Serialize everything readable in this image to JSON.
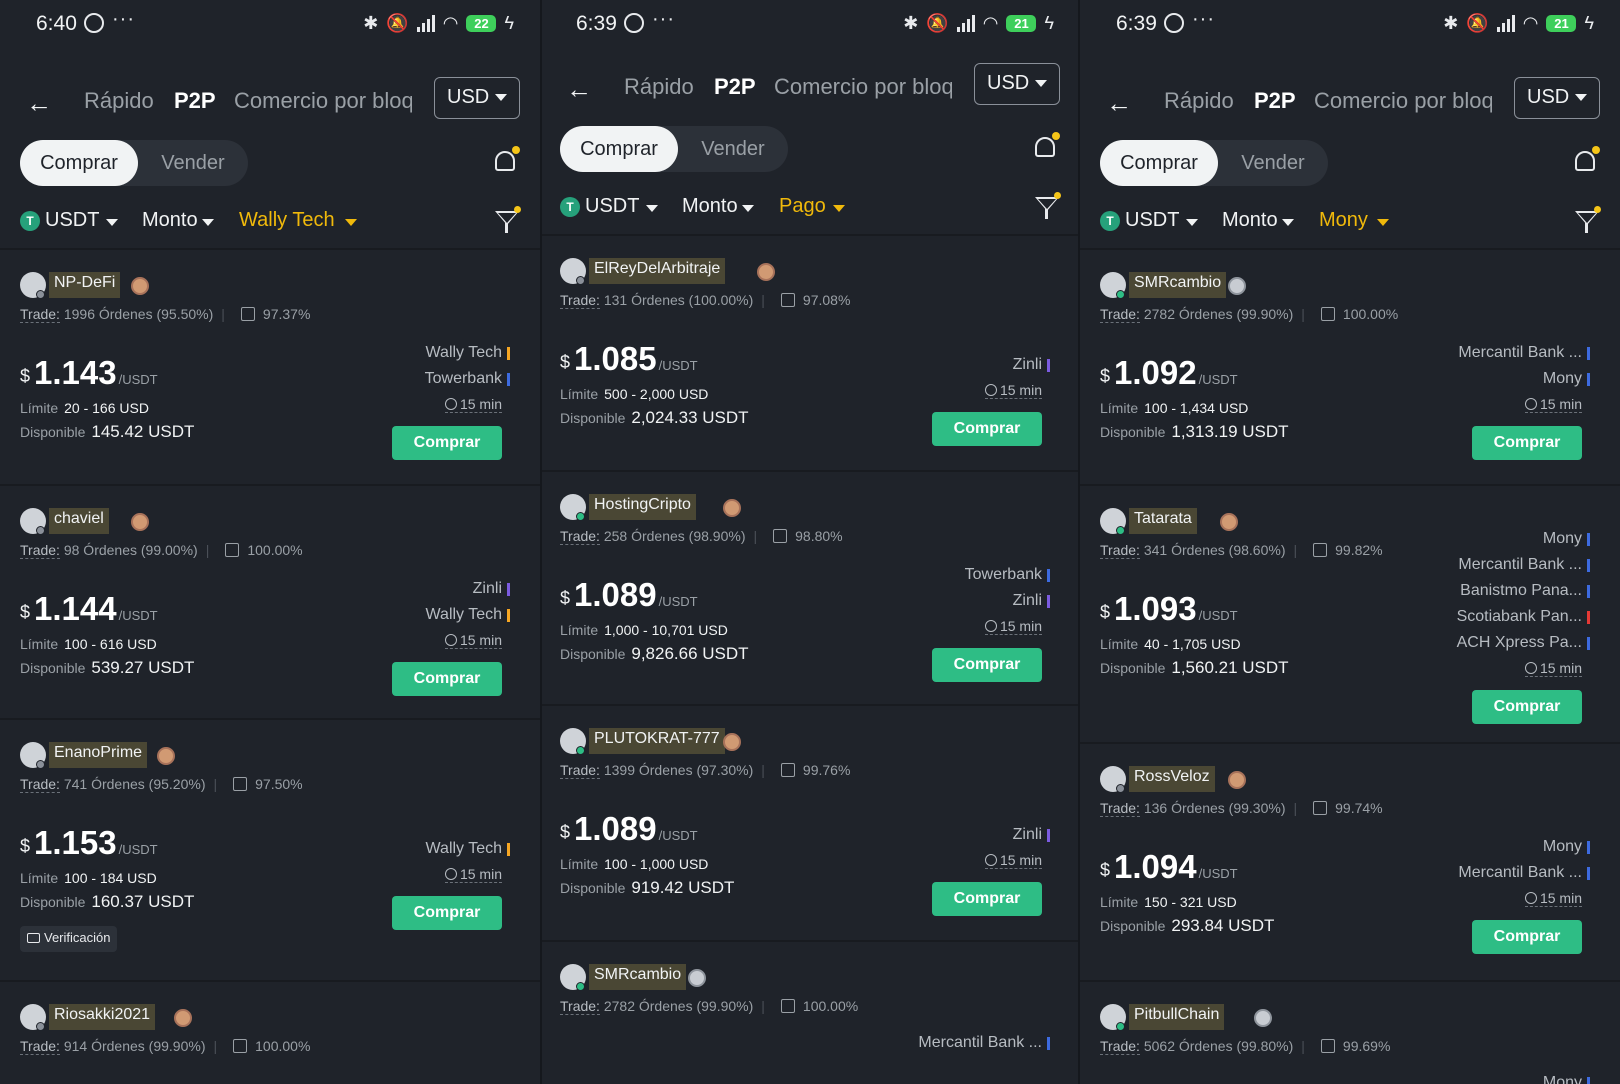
{
  "colors": {
    "background": "#1f232a",
    "buy_button": "#2ebd85",
    "filter_highlight": "#f0b90b",
    "battery": "#3ecf5b",
    "pay_bars": {
      "yellow": "#f5a623",
      "blue": "#3d6be0",
      "purple": "#7b5be0",
      "red": "#e53935"
    }
  },
  "panels": [
    {
      "status": {
        "time": "6:40",
        "dots": "···",
        "battery": "22"
      },
      "header": {
        "back": "←",
        "tab_fast": "Rápido",
        "tab_p2p": "P2P",
        "tab_block": "Comercio por bloq",
        "currency": "USD"
      },
      "toggle": {
        "buy": "Comprar",
        "sell": "Vender"
      },
      "filters": {
        "coin_icon": "T",
        "coin": "USDT",
        "amount": "Monto",
        "payment": "Wally Tech"
      },
      "offers": [
        {
          "name": "NP-DeFi",
          "badge": "bronze",
          "online": false,
          "trade": "Trade:",
          "orders": "1996 Órdenes (95.50%)",
          "rate": "97.37%",
          "currency_sign": "$",
          "price": "1.143",
          "unit": "/USDT",
          "limit_label": "Límite",
          "limit": "20 - 166 USD",
          "avail_label": "Disponible",
          "available": "145.42 USDT",
          "methods": [
            {
              "name": "Wally Tech",
              "color": "#f5a623"
            },
            {
              "name": "Towerbank",
              "color": "#3d6be0"
            }
          ],
          "time": "15 min",
          "button": "Comprar"
        },
        {
          "name": "chaviel",
          "badge": "bronze",
          "online": false,
          "trade": "Trade:",
          "orders": "98 Órdenes (99.00%)",
          "rate": "100.00%",
          "currency_sign": "$",
          "price": "1.144",
          "unit": "/USDT",
          "limit_label": "Límite",
          "limit": "100 - 616 USD",
          "avail_label": "Disponible",
          "available": "539.27 USDT",
          "methods": [
            {
              "name": "Zinli",
              "color": "#7b5be0"
            },
            {
              "name": "Wally Tech",
              "color": "#f5a623"
            }
          ],
          "time": "15 min",
          "button": "Comprar"
        },
        {
          "name": "EnanoPrime",
          "badge": "bronze",
          "online": false,
          "trade": "Trade:",
          "orders": "741 Órdenes (95.20%)",
          "rate": "97.50%",
          "currency_sign": "$",
          "price": "1.153",
          "unit": "/USDT",
          "limit_label": "Límite",
          "limit": "100 - 184 USD",
          "avail_label": "Disponible",
          "available": "160.37 USDT",
          "methods": [
            {
              "name": "Wally Tech",
              "color": "#f5a623"
            }
          ],
          "time": "15 min",
          "button": "Comprar",
          "verification": "Verificación"
        },
        {
          "name": "Riosakki2021",
          "badge": "bronze",
          "online": false,
          "trade": "Trade:",
          "orders": "914 Órdenes (99.90%)",
          "rate": "100.00%"
        }
      ]
    },
    {
      "status": {
        "time": "6:39",
        "dots": "···",
        "battery": "21"
      },
      "header": {
        "back": "←",
        "tab_fast": "Rápido",
        "tab_p2p": "P2P",
        "tab_block": "Comercio por bloq",
        "currency": "USD"
      },
      "toggle": {
        "buy": "Comprar",
        "sell": "Vender"
      },
      "filters": {
        "coin_icon": "T",
        "coin": "USDT",
        "amount": "Monto",
        "payment": "Pago"
      },
      "offers": [
        {
          "name": "ElReyDelArbitraje",
          "badge": "bronze",
          "online": false,
          "trade": "Trade:",
          "orders": "131 Órdenes (100.00%)",
          "rate": "97.08%",
          "currency_sign": "$",
          "price": "1.085",
          "unit": "/USDT",
          "limit_label": "Límite",
          "limit": "500 - 2,000 USD",
          "avail_label": "Disponible",
          "available": "2,024.33 USDT",
          "methods": [
            {
              "name": "Zinli",
              "color": "#7b5be0"
            }
          ],
          "time": "15 min",
          "button": "Comprar"
        },
        {
          "name": "HostingCripto",
          "badge": "bronze",
          "online": true,
          "trade": "Trade:",
          "orders": "258 Órdenes (98.90%)",
          "rate": "98.80%",
          "currency_sign": "$",
          "price": "1.089",
          "unit": "/USDT",
          "limit_label": "Límite",
          "limit": "1,000 - 10,701 USD",
          "avail_label": "Disponible",
          "available": "9,826.66 USDT",
          "methods": [
            {
              "name": "Towerbank",
              "color": "#3d6be0"
            },
            {
              "name": "Zinli",
              "color": "#7b5be0"
            }
          ],
          "time": "15 min",
          "button": "Comprar"
        },
        {
          "name": "PLUTOKRAT-777",
          "badge": "bronze",
          "online": true,
          "trade": "Trade:",
          "orders": "1399 Órdenes (97.30%)",
          "rate": "99.76%",
          "currency_sign": "$",
          "price": "1.089",
          "unit": "/USDT",
          "limit_label": "Límite",
          "limit": "100 - 1,000 USD",
          "avail_label": "Disponible",
          "available": "919.42 USDT",
          "methods": [
            {
              "name": "Zinli",
              "color": "#7b5be0"
            }
          ],
          "time": "15 min",
          "button": "Comprar"
        },
        {
          "name": "SMRcambio",
          "badge": "silver",
          "online": true,
          "trade": "Trade:",
          "orders": "2782 Órdenes (99.90%)",
          "rate": "100.00%",
          "methods": [
            {
              "name": "Mercantil Bank ...",
              "color": "#3d6be0"
            }
          ]
        }
      ]
    },
    {
      "status": {
        "time": "6:39",
        "dots": "···",
        "battery": "21"
      },
      "header": {
        "back": "←",
        "tab_fast": "Rápido",
        "tab_p2p": "P2P",
        "tab_block": "Comercio por bloq",
        "currency": "USD"
      },
      "toggle": {
        "buy": "Comprar",
        "sell": "Vender"
      },
      "filters": {
        "coin_icon": "T",
        "coin": "USDT",
        "amount": "Monto",
        "payment": "Mony"
      },
      "offers": [
        {
          "name": "SMRcambio",
          "badge": "silver",
          "online": true,
          "trade": "Trade:",
          "orders": "2782 Órdenes (99.90%)",
          "rate": "100.00%",
          "currency_sign": "$",
          "price": "1.092",
          "unit": "/USDT",
          "limit_label": "Límite",
          "limit": "100 - 1,434 USD",
          "avail_label": "Disponible",
          "available": "1,313.19 USDT",
          "methods": [
            {
              "name": "Mercantil Bank ...",
              "color": "#3d6be0"
            },
            {
              "name": "Mony",
              "color": "#3d6be0"
            }
          ],
          "time": "15 min",
          "button": "Comprar"
        },
        {
          "name": "Tatarata",
          "badge": "bronze",
          "online": true,
          "trade": "Trade:",
          "orders": "341 Órdenes (98.60%)",
          "rate": "99.82%",
          "currency_sign": "$",
          "price": "1.093",
          "unit": "/USDT",
          "limit_label": "Límite",
          "limit": "40 - 1,705 USD",
          "avail_label": "Disponible",
          "available": "1,560.21 USDT",
          "methods": [
            {
              "name": "Mony",
              "color": "#3d6be0"
            },
            {
              "name": "Mercantil Bank ...",
              "color": "#3d6be0"
            },
            {
              "name": "Banistmo Pana...",
              "color": "#3d6be0"
            },
            {
              "name": "Scotiabank Pan...",
              "color": "#e53935"
            },
            {
              "name": "ACH Xpress Pa...",
              "color": "#3d6be0"
            }
          ],
          "time": "15 min",
          "button": "Comprar"
        },
        {
          "name": "RossVeloz",
          "badge": "bronze",
          "online": false,
          "trade": "Trade:",
          "orders": "136 Órdenes (99.30%)",
          "rate": "99.74%",
          "currency_sign": "$",
          "price": "1.094",
          "unit": "/USDT",
          "limit_label": "Límite",
          "limit": "150 - 321 USD",
          "avail_label": "Disponible",
          "available": "293.84 USDT",
          "methods": [
            {
              "name": "Mony",
              "color": "#3d6be0"
            },
            {
              "name": "Mercantil Bank ...",
              "color": "#3d6be0"
            }
          ],
          "time": "15 min",
          "button": "Comprar"
        },
        {
          "name": "PitbullChain",
          "badge": "silver",
          "online": true,
          "trade": "Trade:",
          "orders": "5062 Órdenes (99.80%)",
          "rate": "99.69%",
          "methods": [
            {
              "name": "Mony",
              "color": "#3d6be0"
            }
          ]
        }
      ]
    }
  ]
}
